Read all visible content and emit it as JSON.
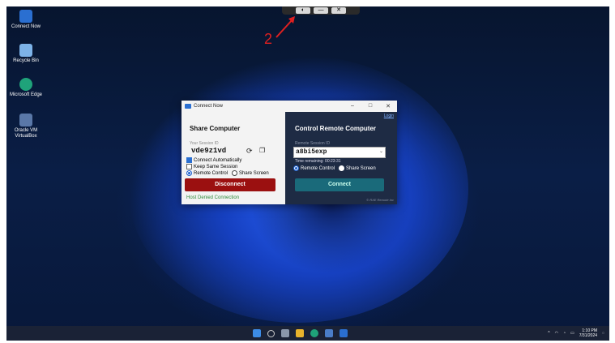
{
  "desktop": {
    "icons": [
      {
        "label": "Connect Now",
        "color": "#2a6fd1"
      },
      {
        "label": "Recycle Bin",
        "color": "#7db3e8"
      },
      {
        "label": "Microsoft Edge",
        "color": "#1fa37a"
      },
      {
        "label": "Oracle VM VirtualBox",
        "color": "#5a78a8"
      }
    ]
  },
  "annotation": {
    "number": "2",
    "color": "#e02020"
  },
  "remote_toolbar": {
    "close_glyph": "✕",
    "min_glyph": "—",
    "toggle_glyph": "◐"
  },
  "window": {
    "title": "Connect Now",
    "login_link": "Login",
    "share": {
      "heading": "Share Computer",
      "session_label": "Your Session ID",
      "session_id": "vde9z1vd",
      "connect_auto": "Connect Automatically",
      "keep_session": "Keep Same Session",
      "remote_control": "Remote Control",
      "share_screen": "Share Screen",
      "disconnect": "Disconnect",
      "status": "Host Denied Connection"
    },
    "control": {
      "heading": "Control Remote Computer",
      "session_label": "Remote Session ID",
      "session_value": "a8bi5exp",
      "time_remaining": "Time remaining: 00:23:31",
      "remote_control": "Remote Control",
      "share_screen": "Share Screen",
      "connect": "Connect",
      "copyright": "© RXE Remote Inc"
    }
  },
  "taskbar": {
    "time": "1:10 PM",
    "date": "7/31/2024"
  },
  "colors": {
    "accent": "#2a6fd1",
    "disconnect": "#9b1010",
    "connect": "#1a6a7a",
    "status_green": "#2e8b3a"
  }
}
